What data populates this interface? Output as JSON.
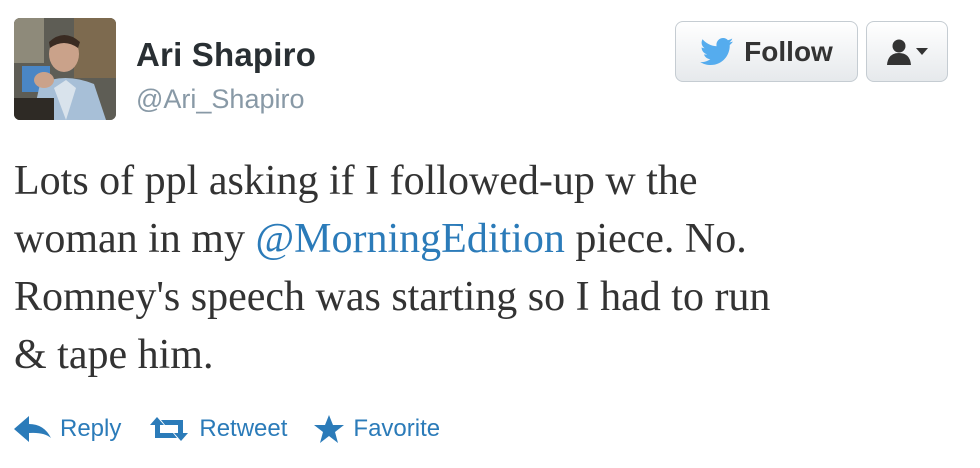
{
  "tweet": {
    "author_name": "Ari Shapiro",
    "author_handle": "@Ari_Shapiro",
    "text_lines": [
      {
        "before": "Lots of ppl asking if I followed-up w the"
      },
      {
        "before": "woman in my ",
        "mention": "@MorningEdition",
        "after": " piece. No."
      },
      {
        "before": "Romney's speech was starting so I had to run"
      },
      {
        "before": "& tape him."
      }
    ]
  },
  "header": {
    "follow_label": "Follow"
  },
  "actions": {
    "reply_label": "Reply",
    "retweet_label": "Retweet",
    "favorite_label": "Favorite"
  },
  "colors": {
    "link": "#2b7bb9",
    "twitter_blue": "#55acee",
    "text": "#333333",
    "muted": "#8899a6"
  },
  "icons": [
    "twitter-bird-icon",
    "user-icon",
    "caret-down-icon",
    "reply-icon",
    "retweet-icon",
    "star-icon"
  ]
}
